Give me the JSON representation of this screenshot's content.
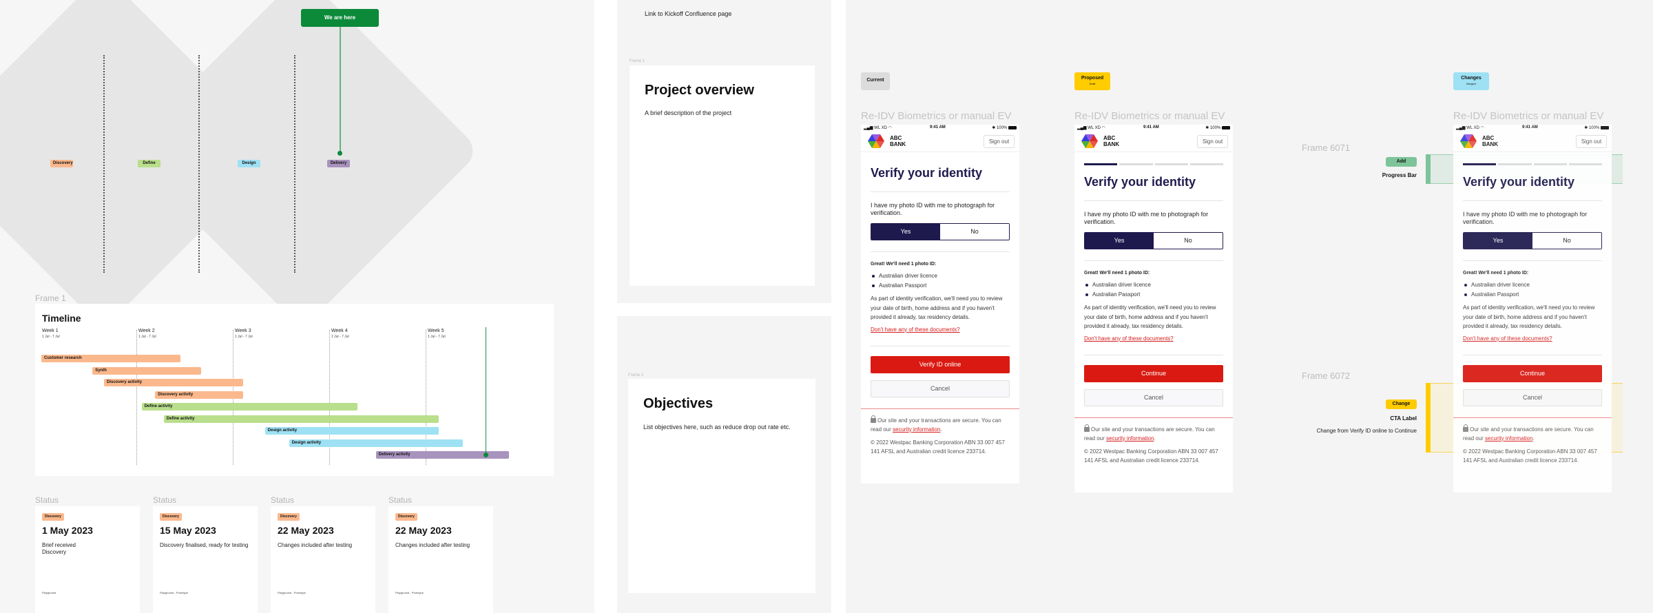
{
  "double_diamond": {
    "phases": [
      {
        "label": "Discovery",
        "color": "#fbb88c"
      },
      {
        "label": "Define",
        "color": "#b9de8c"
      },
      {
        "label": "Design",
        "color": "#9ee1f4"
      },
      {
        "label": "Delivery",
        "color": "#a893bd"
      }
    ],
    "current_marker": "We are here"
  },
  "timeline": {
    "frame_label": "Frame 1",
    "title": "Timeline",
    "weeks": [
      {
        "name": "Week 1",
        "range": "1 Jul - 7 Jul"
      },
      {
        "name": "Week 2",
        "range": "1 Jul - 7 Jul"
      },
      {
        "name": "Week 3",
        "range": "1 Jul - 7 Jul"
      },
      {
        "name": "Week 4",
        "range": "1 Jul - 7 Jul"
      },
      {
        "name": "Week 5",
        "range": "1 Jul - 7 Jul"
      }
    ],
    "activities": [
      {
        "label": "Customer research",
        "phase": "Discovery",
        "start_week": 0.0,
        "end_week": 1.44
      },
      {
        "label": "Synth",
        "phase": "Discovery",
        "start_week": 0.53,
        "end_week": 1.66
      },
      {
        "label": "Discovery activity",
        "phase": "Discovery",
        "start_week": 0.65,
        "end_week": 2.09
      },
      {
        "label": "Discovery activity",
        "phase": "Discovery",
        "start_week": 1.18,
        "end_week": 2.09
      },
      {
        "label": "Define activity",
        "phase": "Define",
        "start_week": 1.04,
        "end_week": 3.28
      },
      {
        "label": "Define activity",
        "phase": "Define",
        "start_week": 1.27,
        "end_week": 4.12
      },
      {
        "label": "Design activity",
        "phase": "Design",
        "start_week": 2.32,
        "end_week": 4.12
      },
      {
        "label": "Design activity",
        "phase": "Design",
        "start_week": 2.57,
        "end_week": 4.37
      },
      {
        "label": "Delivery activity",
        "phase": "Delivery",
        "start_week": 3.47,
        "end_week": 4.85
      }
    ],
    "current_week": 4.6
  },
  "status_cards": [
    {
      "section_label": "Status",
      "tag": "Discovery",
      "date": "1 May 2023",
      "description": "Brief received\nDiscovery",
      "footer": "Playground"
    },
    {
      "section_label": "Status",
      "tag": "Discovery",
      "date": "15 May 2023",
      "description": "Discovery finalised, ready for testing",
      "footer": "Playground - Prototype"
    },
    {
      "section_label": "Status",
      "tag": "Discovery",
      "date": "22 May 2023",
      "description": "Changes included after testing",
      "footer": "Playground - Prototype"
    },
    {
      "section_label": "Status",
      "tag": "Discovery",
      "date": "22 May 2023",
      "description": "Changes included after testing",
      "footer": "Playground - Prototype"
    }
  ],
  "middle": {
    "link_text": "Link to Kickoff Confluence page",
    "overview": {
      "frame_label": "Frame 1",
      "title": "Project overview",
      "description": "A brief description of the project"
    },
    "objectives": {
      "frame_label": "Frame 2",
      "title": "Objectives",
      "description": "List objectives here, such as reduce drop out rate etc."
    }
  },
  "screens": [
    {
      "version": {
        "label": "Current",
        "sub": "",
        "color": "#dcdcdc"
      },
      "title": "Re-IDV Biometrics or manual EV",
      "show_progress": false,
      "primary_cta": "Verify ID online"
    },
    {
      "version": {
        "label": "Proposed",
        "sub": "Draft",
        "color": "#ffcc00"
      },
      "title": "Re-IDV Biometrics or manual EV",
      "show_progress": true,
      "primary_cta": "Continue"
    },
    {
      "version": {
        "label": "Changes",
        "sub": "Merged",
        "color": "#9ee1f4"
      },
      "title": "Re-IDV Biometrics or manual EV",
      "show_progress": true,
      "primary_cta": "Continue"
    }
  ],
  "phone": {
    "status_left": "WL XD",
    "time": "9:41 AM",
    "battery": "100%",
    "bank_name_line1": "ABC",
    "bank_name_line2": "BANK",
    "sign_out": "Sign out",
    "progress": {
      "current_step": 1,
      "total_steps": 4
    },
    "heading": "Verify your identity",
    "question": "I have my photo ID with me to photograph for verification.",
    "yes_label": "Yes",
    "no_label": "No",
    "selected": "Yes",
    "need_text": "Great! We'll need 1 photo ID:",
    "id_options": [
      "Australian driver licence",
      "Australian Passport"
    ],
    "info_text": "As part of identity verification, we'll need you to review your date of birth, home address and if you haven't provided it already, tax residency details.",
    "no_docs_link": "Don't have any of these documents?",
    "cancel_label": "Cancel",
    "secure_text": "Our site and your transactions are secure. You can read our",
    "secure_link": "security information",
    "copyright": "© 2022 Westpac Banking Corporation ABN 33 007 457 141 AFSL and Australian credit licence 233714."
  },
  "annotations": [
    {
      "frame_label": "Frame 6071",
      "tag": "Add",
      "tag_color": "#7dc49a",
      "title": "Progress Bar",
      "description": ""
    },
    {
      "frame_label": "Frame 6072",
      "tag": "Change",
      "tag_color": "#ffcc00",
      "title": "CTA Label",
      "description": "Change from Verify ID online to Continue"
    }
  ]
}
